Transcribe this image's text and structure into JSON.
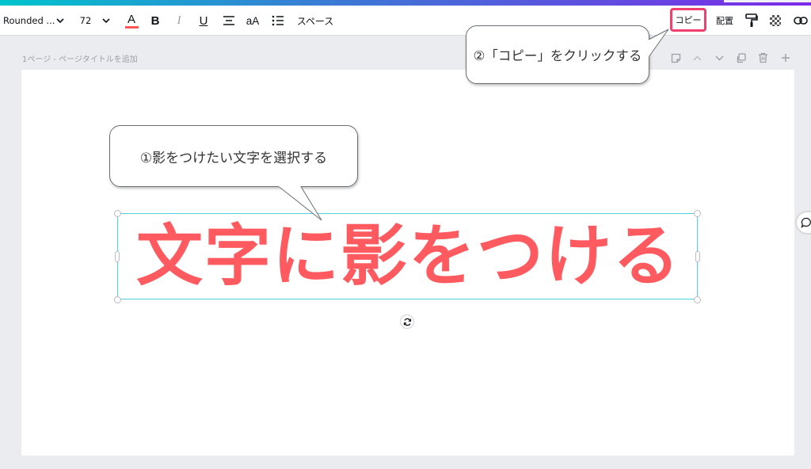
{
  "toolbar": {
    "font_name": "Rounded ...",
    "font_size": "72",
    "color_letter": "A",
    "bold": "B",
    "italic": "I",
    "underline": "U",
    "case": "aA",
    "spacing": "スペース",
    "copy": "コピー",
    "position": "配置",
    "text_color": "#ff5757",
    "copy_highlight": "#f0406e"
  },
  "page": {
    "title_prefix": "1ページ - ",
    "title_placeholder": "ページタイトルを追加"
  },
  "canvas": {
    "headline": "文字に影をつける",
    "headline_color": "#ff5a5f"
  },
  "annotations": {
    "step1": "①影をつけたい文字を選択する",
    "step2": "②「コピー」をクリックする"
  },
  "icons": {
    "font_chevron": "chevron-down-icon",
    "size_chevron": "chevron-down-icon",
    "align": "align-center-icon",
    "list": "list-icon",
    "paint": "paint-roller-icon",
    "transparency": "transparency-icon",
    "link": "link-icon",
    "note": "note-icon",
    "up": "chevron-up-icon",
    "down": "chevron-down-icon",
    "duplicate": "duplicate-icon",
    "delete": "trash-icon",
    "add": "plus-icon",
    "rotate": "rotate-icon",
    "comment": "comment-icon"
  }
}
